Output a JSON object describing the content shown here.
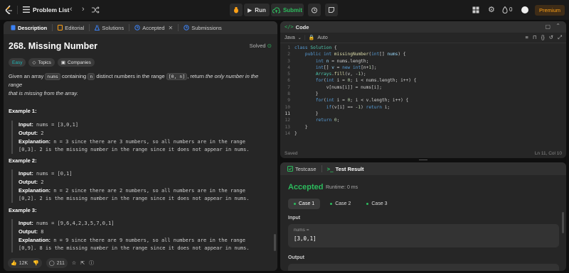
{
  "nav": {
    "problem_list": "Problem List",
    "run_label": "Run",
    "submit_label": "Submit",
    "streak_count": "0",
    "premium_label": "Premium"
  },
  "description": {
    "tabs": [
      {
        "label": "Description"
      },
      {
        "label": "Editorial"
      },
      {
        "label": "Solutions"
      },
      {
        "label": "Accepted"
      },
      {
        "label": "Submissions"
      }
    ],
    "title": "268. Missing Number",
    "solved_label": "Solved",
    "tags": [
      "Easy",
      "Topics",
      "Companies"
    ],
    "statement": {
      "p1": "Given an array ",
      "code1": "nums",
      "p2": " containing ",
      "code2": "n",
      "p3": " distinct numbers in the range ",
      "code3": "[0, n]",
      "p4": ", return ",
      "em1": "the only number in the range",
      "em2": "that is missing from the array."
    },
    "examples": [
      {
        "title": "Example 1:",
        "input_label": "Input:",
        "input": " nums = [3,0,1]",
        "output_label": "Output:",
        "output": " 2",
        "explanation_label": "Explanation:",
        "explanation1": " n = 3 since there are 3 numbers, so all numbers are in the range",
        "explanation2": "[0,3]. 2 is the missing number in the range since it does not appear in nums."
      },
      {
        "title": "Example 2:",
        "input_label": "Input:",
        "input": " nums = [0,1]",
        "output_label": "Output:",
        "output": " 2",
        "explanation_label": "Explanation:",
        "explanation1": " n = 2 since there are 2 numbers, so all numbers are in the range",
        "explanation2": "[0,2]. 2 is the missing number in the range since it does not appear in nums."
      },
      {
        "title": "Example 3:",
        "input_label": "Input:",
        "input": " nums = [9,6,4,2,3,5,7,0,1]",
        "output_label": "Output:",
        "output": " 8",
        "explanation_label": "Explanation:",
        "explanation1": " n = 9 since there are 9 numbers, so all numbers are in the range",
        "explanation2": "[0,9]. 8 is the missing number in the range since it does not appear in nums."
      }
    ],
    "likes": "12K",
    "comments": "211"
  },
  "code": {
    "tab_label": "Code",
    "language": "Java",
    "mode": "Auto",
    "saved_label": "Saved",
    "cursor_pos": "Ln 11, Col 10",
    "current_line": 11
  },
  "test": {
    "tabs": [
      {
        "label": "Testcase"
      },
      {
        "label": "Test Result"
      }
    ],
    "status": "Accepted",
    "runtime": "Runtime: 0 ms",
    "cases": [
      "Case 1",
      "Case 2",
      "Case 3"
    ],
    "input_label": "Input",
    "var_name": "nums =",
    "var_value": "[3,0,1]",
    "output_label": "Output"
  },
  "colors": {
    "accent_green": "#2cbb5d",
    "premium_orange": "#ffa116",
    "easy_teal": "#1cbaba"
  }
}
